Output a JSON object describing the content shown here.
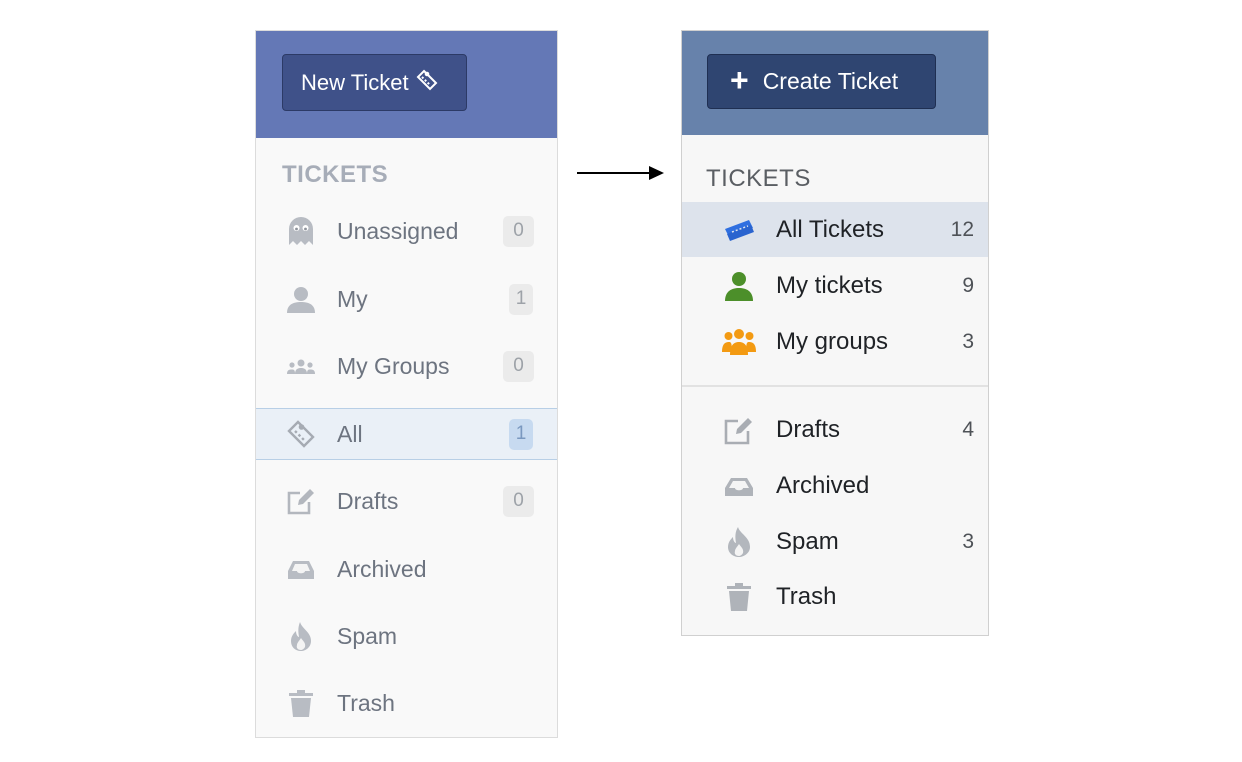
{
  "old_sidebar": {
    "new_ticket_label": "New Ticket",
    "section_title": "TICKETS",
    "items": [
      {
        "label": "Unassigned",
        "count": "0",
        "icon": "ghost-icon"
      },
      {
        "label": "My",
        "count": "1",
        "icon": "user-icon"
      },
      {
        "label": "My Groups",
        "count": "0",
        "icon": "group-icon"
      },
      {
        "label": "All",
        "count": "1",
        "icon": "ticket-icon",
        "active": true
      },
      {
        "label": "Drafts",
        "count": "0",
        "icon": "edit-icon"
      },
      {
        "label": "Archived",
        "count": "",
        "icon": "inbox-icon"
      },
      {
        "label": "Spam",
        "count": "",
        "icon": "flame-icon"
      },
      {
        "label": "Trash",
        "count": "",
        "icon": "trash-icon"
      }
    ]
  },
  "new_sidebar": {
    "create_ticket_label": "Create Ticket",
    "section_title": "TICKETS",
    "items": [
      {
        "label": "All Tickets",
        "count": "12",
        "icon": "tickets-icon",
        "active": true
      },
      {
        "label": "My tickets",
        "count": "9",
        "icon": "user-icon"
      },
      {
        "label": "My groups",
        "count": "3",
        "icon": "group-icon"
      },
      {
        "label": "Drafts",
        "count": "4",
        "icon": "edit-icon"
      },
      {
        "label": "Archived",
        "count": "",
        "icon": "inbox-icon"
      },
      {
        "label": "Spam",
        "count": "3",
        "icon": "flame-icon"
      },
      {
        "label": "Trash",
        "count": "",
        "icon": "trash-icon"
      }
    ]
  },
  "colors": {
    "old_header": "#6478b6",
    "old_button": "#3f5189",
    "new_header": "#6782ab",
    "new_button": "#2f4571",
    "all_tickets_icon": "#2f6fe0",
    "my_tickets_icon": "#4c8f2a",
    "my_groups_icon": "#f39a12"
  }
}
